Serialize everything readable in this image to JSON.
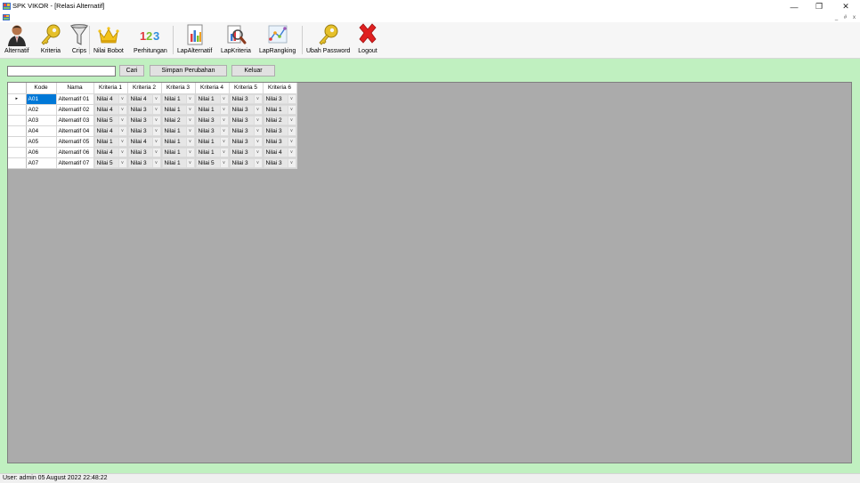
{
  "window": {
    "title": "SPK VIKOR - [Relasi Alternatif]",
    "controls": {
      "minimize": "—",
      "restore": "❐",
      "close": "✕"
    },
    "mdi_controls": {
      "minimize": "_",
      "restore": "#",
      "close": "x"
    }
  },
  "toolbar": {
    "items": [
      {
        "label": "Alternatif",
        "icon": "user-icon"
      },
      {
        "label": "Kriteria",
        "icon": "key-icon"
      },
      {
        "label": "Crips",
        "icon": "funnel-icon"
      },
      {
        "label": "Nilai Bobot",
        "icon": "crown-icon"
      },
      {
        "label": "Perhitungan",
        "icon": "numbers-icon"
      },
      {
        "label": "LapAlternatif",
        "icon": "report-chart-icon"
      },
      {
        "label": "LapKriteria",
        "icon": "report-search-icon"
      },
      {
        "label": "LapRangking",
        "icon": "ranking-icon"
      },
      {
        "label": "Ubah Password",
        "icon": "key-icon"
      },
      {
        "label": "Logout",
        "icon": "close-icon"
      }
    ]
  },
  "search": {
    "value": "",
    "placeholder": ""
  },
  "buttons": {
    "search": "Cari",
    "save": "Simpan Perubahan",
    "exit": "Keluar"
  },
  "grid": {
    "columns": [
      "Kode",
      "Nama",
      "Kriteria 1",
      "Kriteria 2",
      "Kriteria 3",
      "Kriteria 4",
      "Kriteria 5",
      "Kriteria 6"
    ],
    "current_row_marker": "▸",
    "rows": [
      {
        "kode": "A01",
        "nama": "Alternatif 01",
        "values": [
          "Nilai 4",
          "Nilai 4",
          "Nilai 1",
          "Nilai 1",
          "Nilai 3",
          "Nilai 3"
        ]
      },
      {
        "kode": "A02",
        "nama": "Alternatif 02",
        "values": [
          "Nilai 4",
          "Nilai 3",
          "Nilai 1",
          "Nilai 1",
          "Nilai 3",
          "Nilai 1"
        ]
      },
      {
        "kode": "A03",
        "nama": "Alternatif 03",
        "values": [
          "Nilai 5",
          "Nilai 3",
          "Nilai 2",
          "Nilai 3",
          "Nilai 3",
          "Nilai 2"
        ]
      },
      {
        "kode": "A04",
        "nama": "Alternatif 04",
        "values": [
          "Nilai 4",
          "Nilai 3",
          "Nilai 1",
          "Nilai 3",
          "Nilai 3",
          "Nilai 3"
        ]
      },
      {
        "kode": "A05",
        "nama": "Alternatif 05",
        "values": [
          "Nilai 1",
          "Nilai 4",
          "Nilai 1",
          "Nilai 1",
          "Nilai 3",
          "Nilai 3"
        ]
      },
      {
        "kode": "A06",
        "nama": "Alternatif 06",
        "values": [
          "Nilai 4",
          "Nilai 3",
          "Nilai 1",
          "Nilai 1",
          "Nilai 3",
          "Nilai 4"
        ]
      },
      {
        "kode": "A07",
        "nama": "Alternatif 07",
        "values": [
          "Nilai 5",
          "Nilai 3",
          "Nilai 1",
          "Nilai 5",
          "Nilai 3",
          "Nilai 3"
        ]
      }
    ]
  },
  "status": {
    "text": "User: admin  05 August 2022 22:48:22"
  },
  "colors": {
    "content_bg": "#c0f0c0",
    "grid_bg": "#ababab",
    "selection": "#0078d7",
    "logout_red": "#e02020"
  }
}
